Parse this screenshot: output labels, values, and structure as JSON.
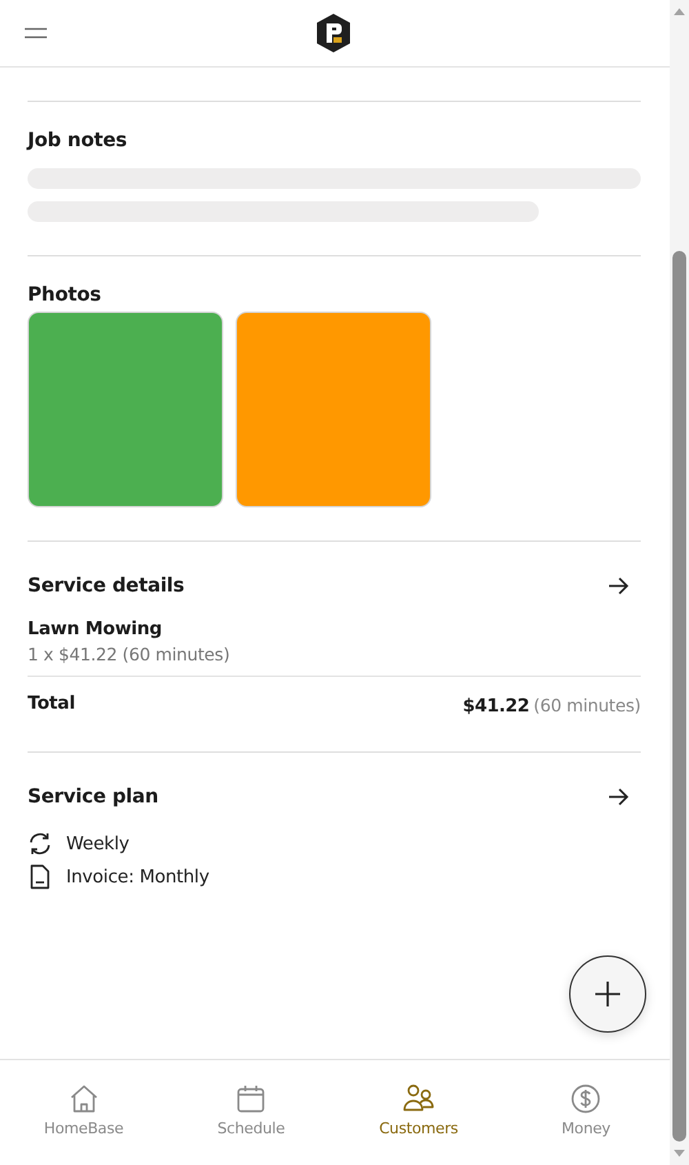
{
  "job_notes": {
    "title": "Job notes",
    "loading": true
  },
  "photos": {
    "title": "Photos",
    "items": [
      {
        "color": "#4caf50"
      },
      {
        "color": "#ff9800"
      }
    ]
  },
  "service_details": {
    "title": "Service details",
    "items": [
      {
        "name": "Lawn Mowing",
        "detail": "1 x $41.22 (60 minutes)"
      }
    ],
    "total_label": "Total",
    "total_amount": "$41.22",
    "total_duration": "(60 minutes)"
  },
  "service_plan": {
    "title": "Service plan",
    "rows": [
      {
        "kind": "repeat",
        "text": "Weekly"
      },
      {
        "kind": "invoice",
        "text": "Invoice: Monthly"
      }
    ]
  },
  "nav": [
    {
      "kind": "home",
      "label": "HomeBase",
      "selected": false
    },
    {
      "kind": "calendar",
      "label": "Schedule",
      "selected": false
    },
    {
      "kind": "people",
      "label": "Customers",
      "selected": true
    },
    {
      "kind": "money",
      "label": "Money",
      "selected": false
    }
  ]
}
